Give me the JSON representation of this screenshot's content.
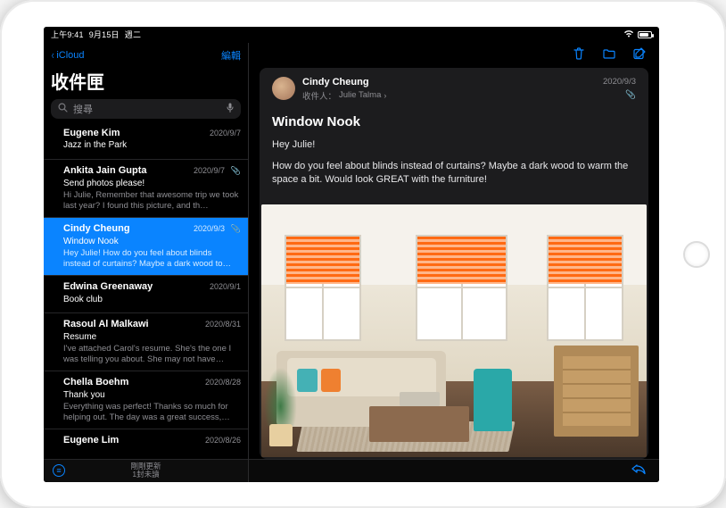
{
  "status": {
    "time": "上午9:41",
    "date": "9月15日",
    "weekday": "週二",
    "wifi_icon": "wifi-icon",
    "battery_percent": 70
  },
  "colors": {
    "accent": "#0a84ff"
  },
  "sidebar": {
    "back_label": "iCloud",
    "edit_label": "編輯",
    "title": "收件匣",
    "search_placeholder": "搜尋",
    "footer_line1": "剛剛更新",
    "footer_line2": "1封未讀",
    "items": [
      {
        "sender": "Eugene Kim",
        "date": "2020/9/7",
        "subject": "Jazz in the Park",
        "preview": "",
        "has_attachment": false
      },
      {
        "sender": "Ankita Jain Gupta",
        "date": "2020/9/7",
        "subject": "Send photos please!",
        "preview": "Hi Julie, Remember that awesome trip we took last year? I found this picture, and th…",
        "has_attachment": true
      },
      {
        "sender": "Cindy Cheung",
        "date": "2020/9/3",
        "subject": "Window Nook",
        "preview": "Hey Julie! How do you feel about blinds instead of curtains? Maybe a dark wood to…",
        "has_attachment": true,
        "selected": true
      },
      {
        "sender": "Edwina Greenaway",
        "date": "2020/9/1",
        "subject": "Book club",
        "preview": "",
        "has_attachment": false
      },
      {
        "sender": "Rasoul Al Malkawi",
        "date": "2020/8/31",
        "subject": "Resume",
        "preview": "I've attached Carol's resume. She's the one I was telling you about. She may not have…",
        "has_attachment": false
      },
      {
        "sender": "Chella Boehm",
        "date": "2020/8/28",
        "subject": "Thank you",
        "preview": "Everything was perfect! Thanks so much for helping out. The day was a great success,…",
        "has_attachment": false
      },
      {
        "sender": "Eugene Lim",
        "date": "2020/8/26",
        "subject": "",
        "preview": "",
        "has_attachment": false
      }
    ]
  },
  "content": {
    "toolbar": {
      "trash": "trash-icon",
      "move": "folder-icon",
      "compose": "compose-icon"
    },
    "from": "Cindy Cheung",
    "to_label": "收件人：",
    "to_name": "Julie Talma",
    "date": "2020/9/3",
    "subject": "Window Nook",
    "greeting": "Hey Julie!",
    "body": "How do you feel about blinds instead of curtains? Maybe a dark wood to warm the space a bit. Would look GREAT with the furniture!",
    "attachment_desc": "living-room-photo-with-orange-blind-markup",
    "reply_icon": "reply-icon"
  }
}
